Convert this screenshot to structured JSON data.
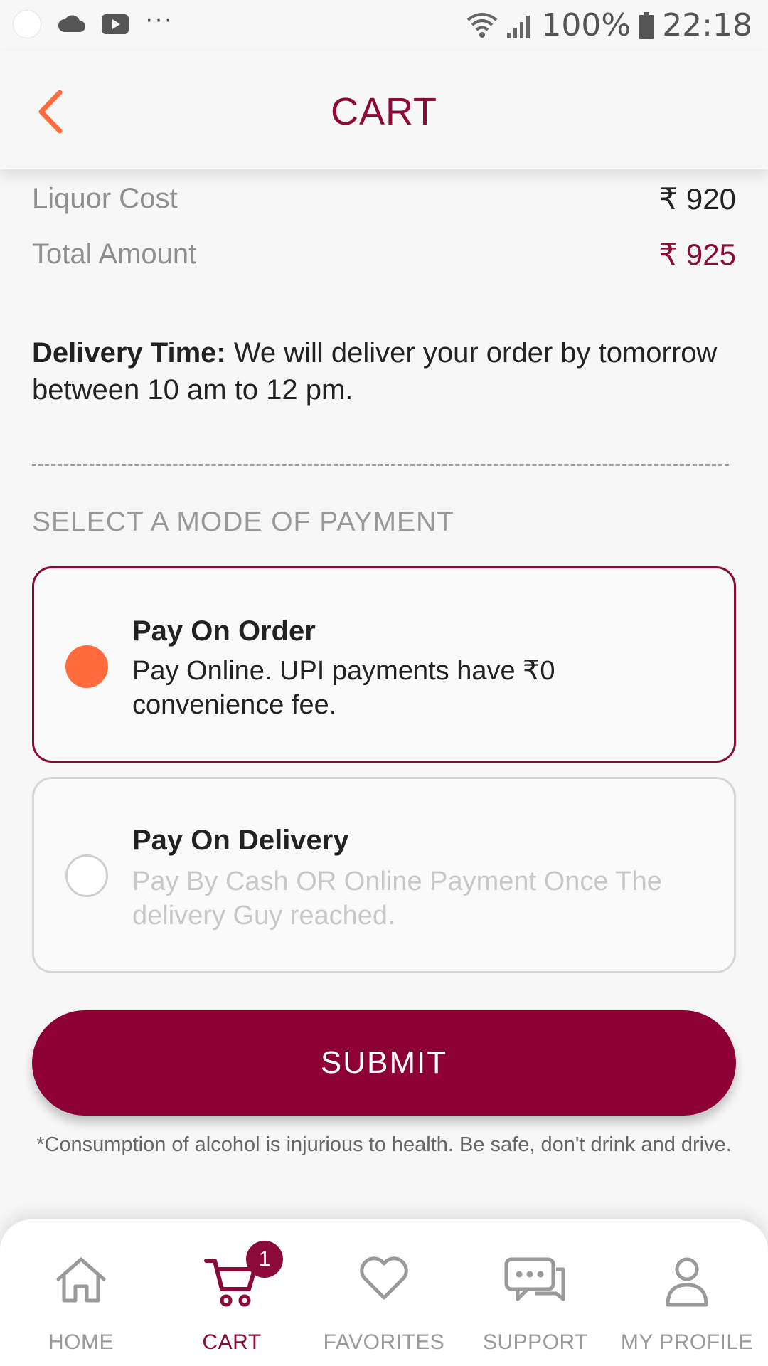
{
  "status_bar": {
    "battery": "100%",
    "time": "22:18",
    "left_icons": [
      "notification-dot-icon",
      "cloud-icon",
      "youtube-icon",
      "more-dots-icon"
    ],
    "right_icons": [
      "wifi-icon",
      "signal-icon",
      "battery-icon"
    ]
  },
  "header": {
    "title": "CART",
    "back_icon": "chevron-left-icon"
  },
  "summary": {
    "liquor_cost_label": "Liquor Cost",
    "liquor_cost_value": "₹ 920",
    "total_label": "Total Amount",
    "total_value": "₹ 925"
  },
  "delivery": {
    "label": "Delivery Time:",
    "text": " We will deliver your order by tomorrow between 10 am to 12 pm."
  },
  "payment": {
    "heading": "SELECT A MODE OF PAYMENT",
    "options": [
      {
        "title": "Pay On Order",
        "description": "Pay Online. UPI payments have ₹0 convenience fee.",
        "selected": true
      },
      {
        "title": "Pay On Delivery",
        "description": "Pay By Cash OR Online Payment Once The delivery Guy reached.",
        "selected": false
      }
    ]
  },
  "submit": {
    "label": "SUBMIT"
  },
  "disclaimer": "*Consumption of alcohol is injurious to health. Be safe, don't drink and drive.",
  "nav": {
    "items": [
      {
        "label": "HOME",
        "icon": "home-icon",
        "active": false
      },
      {
        "label": "CART",
        "icon": "cart-icon",
        "active": true,
        "badge": "1"
      },
      {
        "label": "FAVORITES",
        "icon": "heart-icon",
        "active": false
      },
      {
        "label": "SUPPORT",
        "icon": "chat-icon",
        "active": false
      },
      {
        "label": "MY PROFILE",
        "icon": "user-icon",
        "active": false
      }
    ]
  },
  "colors": {
    "brand": "#8c0a3a",
    "accent": "#ff6b3c",
    "button": "#8c0034",
    "muted_text": "#9a9a9a"
  }
}
